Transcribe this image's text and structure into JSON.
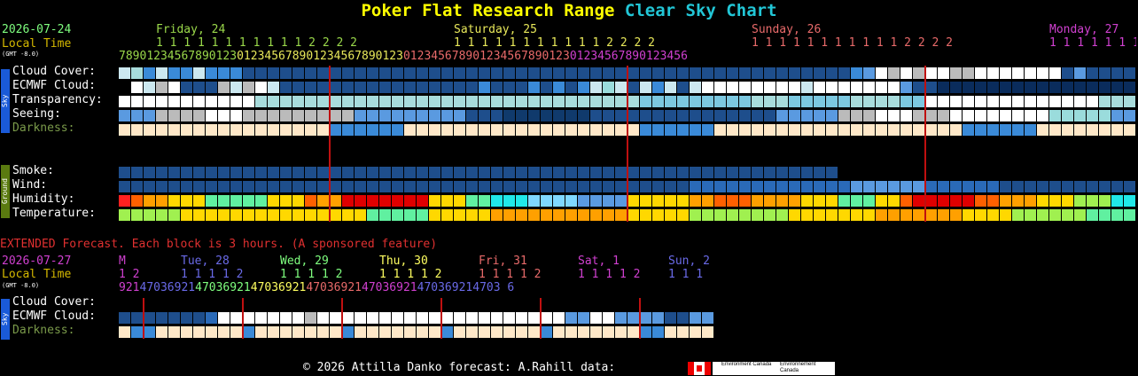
{
  "title_main": "Poker Flat Research Range",
  "title_sub": "Clear Sky Chart",
  "date": "2026-07-24",
  "local_time": "Local Time",
  "gmt": "(GMT -8.0)",
  "days": [
    {
      "label": "Friday, 24",
      "color": "#9ad84a"
    },
    {
      "label": "Saturday, 25",
      "color": "#e8e85a"
    },
    {
      "label": "Sunday, 26",
      "color": "#e86a6a"
    },
    {
      "label": "Monday, 27",
      "color": "#d040d0"
    }
  ],
  "hour_tens_row": "1 1 1 1 1 1 1 1 1 1 1 2 2 2 2",
  "hours_text": "7890123456789012301234567890123456789012301234567890123456789012301234567890123456",
  "sky_side": "Sky",
  "ground_side": "Ground",
  "rows": {
    "cloud": "Cloud Cover:",
    "ecmwf": "ECMWF Cloud:",
    "transparency": "Transparency:",
    "seeing": "Seeing:",
    "darkness": "Darkness:",
    "smoke": "Smoke:",
    "wind": "Wind:",
    "humidity": "Humidity:",
    "temperature": "Temperature:"
  },
  "extended": {
    "heading": "EXTENDED Forecast. Each block is 3 hours. (A sponsored feature)",
    "date": "2026-07-27",
    "local_time": "Local Time",
    "gmt": "(GMT -8.0)",
    "days": [
      {
        "label": "M",
        "color": "#d040d0"
      },
      {
        "label": "Tue, 28",
        "color": "#6a6ae8"
      },
      {
        "label": "Wed, 29",
        "color": "#7fff7f"
      },
      {
        "label": "Thu, 30",
        "color": "#ffff60"
      },
      {
        "label": "Fri, 31",
        "color": "#e86a6a"
      },
      {
        "label": "Sat, 1",
        "color": "#d040d0"
      },
      {
        "label": "Sun, 2",
        "color": "#6a6ae8"
      }
    ],
    "tens": [
      "1 2",
      "1 1 1 1 2",
      "1 1 1 1 2",
      "1 1 1 1 2",
      "1 1 1 1 2",
      "1 1 1 1 2",
      "1 1 1"
    ],
    "hours": "9214703692147036921470369214703692147036921470369214703 6",
    "cloud": "Cloud Cover:",
    "ecmwf": "ECMWF Cloud:",
    "darkness": "Darkness:",
    "sky_side": "Sky"
  },
  "footer": {
    "copyright": "© 2026 Attilla Danko  forecast: A.Rahill  data:",
    "env1": "Environment Canada",
    "env2": "Environnement Canada"
  },
  "colors": {
    "accent_yellow": "#ffff00",
    "accent_cyan": "#22c6d6",
    "noon_line": "#c01010"
  }
}
